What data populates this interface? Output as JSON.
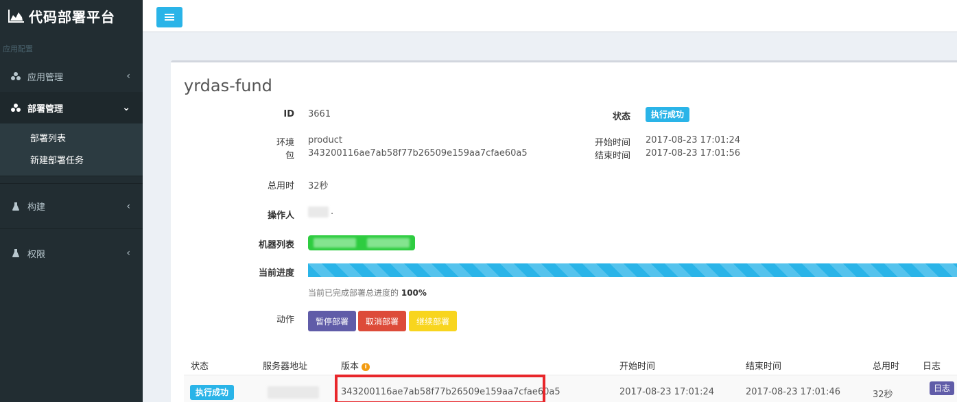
{
  "brand": {
    "title": "代码部署平台",
    "icon": "area-chart-icon"
  },
  "sidebar": {
    "section_header": "应用配置",
    "items": [
      {
        "label": "应用管理",
        "icon": "cubes-icon",
        "active": false
      },
      {
        "label": "部署管理",
        "icon": "cubes-icon",
        "active": true,
        "children": [
          {
            "label": "部署列表"
          },
          {
            "label": "新建部署任务"
          }
        ]
      },
      {
        "label": "构建",
        "icon": "flask-icon",
        "active": false
      },
      {
        "label": "权限",
        "icon": "flask-icon",
        "active": false
      }
    ]
  },
  "topbar": {
    "toggle_icon": "hamburger-icon"
  },
  "detail": {
    "title": "yrdas-fund",
    "id_label": "ID",
    "id_value": "3661",
    "status_label": "状态",
    "status_value": "执行成功",
    "env_label": "环境",
    "env_value": "product",
    "pkg_label": "包",
    "pkg_value": "343200116ae7ab58f77b26509e159aa7cfae60a5",
    "start_label": "开始时间",
    "start_value": "2017-08-23 17:01:24",
    "end_label": "结束时间",
    "end_value": "2017-08-23 17:01:56",
    "duration_label": "总用时",
    "duration_value": "32秒",
    "operator_label": "操作人",
    "operator_suffix": ".",
    "machines_label": "机器列表",
    "progress_label": "当前进度",
    "progress_percent": 100,
    "progress_text_prefix": "当前已完成部署总进度的",
    "progress_text_value": "100%",
    "actions_label": "动作",
    "actions": [
      {
        "label": "暂停部署",
        "color": "#605ca8"
      },
      {
        "label": "取消部署",
        "color": "#dd4b39"
      },
      {
        "label": "继续部署",
        "color": "#f8d51e"
      }
    ]
  },
  "table": {
    "headers": [
      "状态",
      "服务器地址",
      "版本",
      "开始时间",
      "结束时间",
      "总用时",
      "日志"
    ],
    "rows": [
      {
        "status": "执行成功",
        "server": "",
        "version": "343200116ae7ab58f77b26509e159aa7cfae60a5",
        "start": "2017-08-23 17:01:24",
        "end": "2017-08-23 17:01:46",
        "duration": "32秒",
        "log": "日志"
      }
    ]
  },
  "colors": {
    "accent": "#2ab4e8",
    "sidebar_bg": "#222d32",
    "highlight": "#e8262a"
  }
}
